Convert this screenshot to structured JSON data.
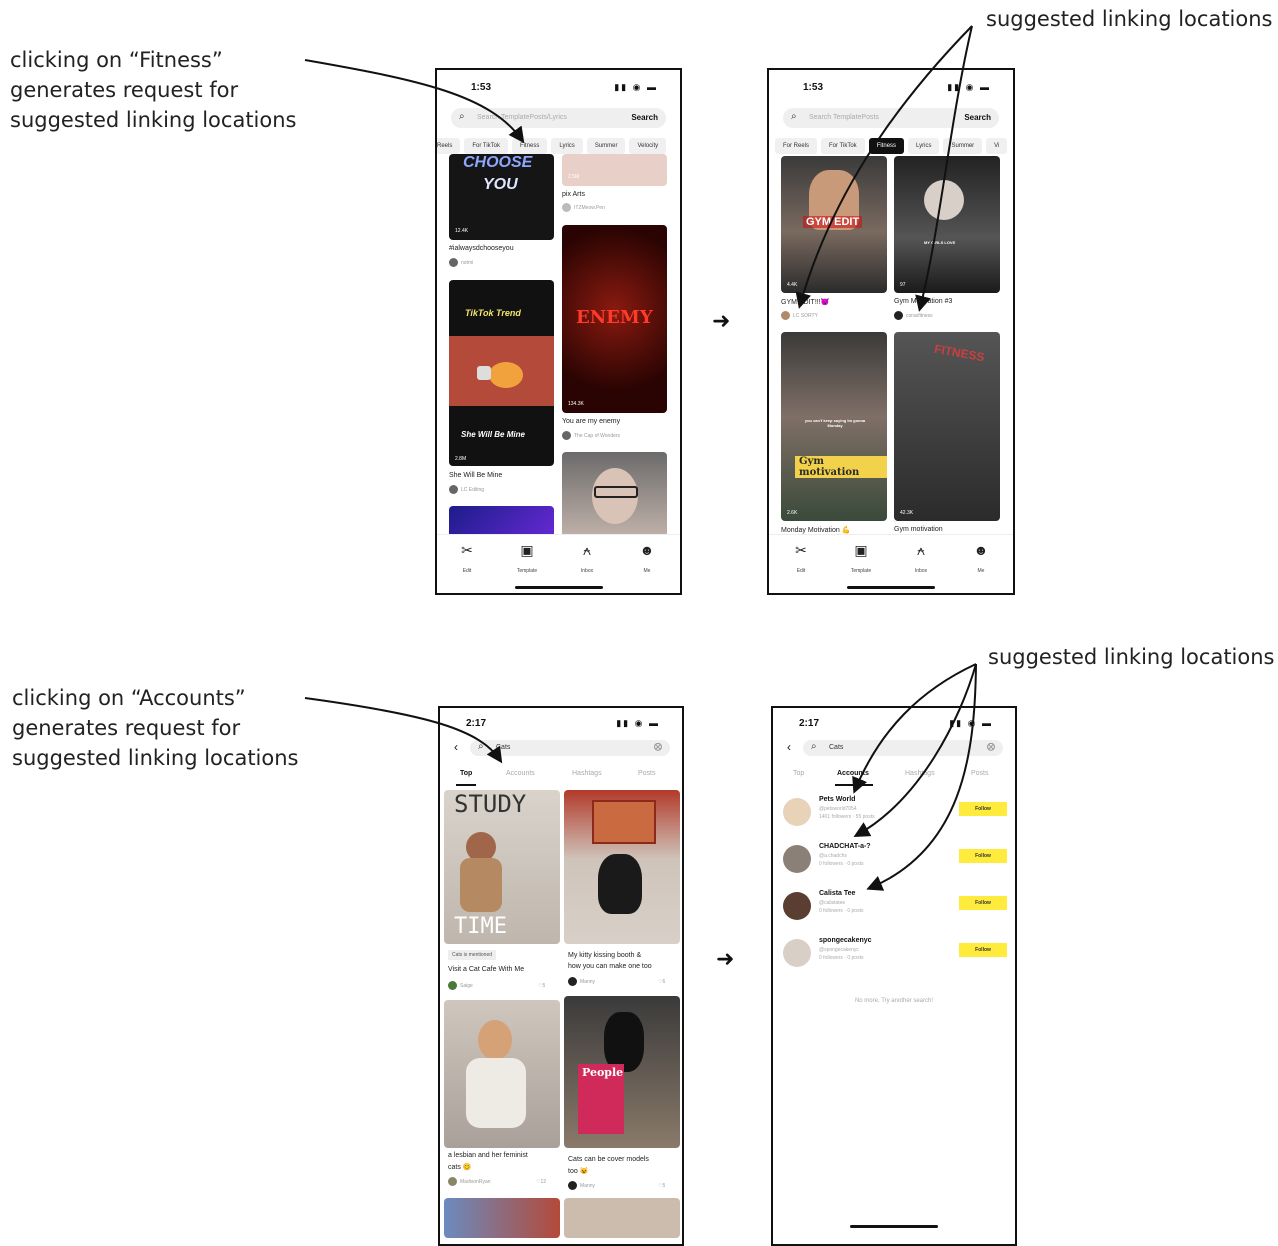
{
  "annotations": {
    "fitness_click_lines": [
      "clicking on “Fitness”",
      "generates request for",
      "suggested linking locations"
    ],
    "accounts_click_lines": [
      "clicking on “Accounts”",
      "generates request for",
      "suggested linking locations"
    ],
    "suggested_top": "suggested linking locations",
    "suggested_bottom": "suggested linking locations"
  },
  "fitness_before": {
    "time": "1:53",
    "search_placeholder": "Search TemplatePosts/Lyrics",
    "search_button": "Search",
    "chips": [
      "Reels",
      "For TikTok",
      "Fitness",
      "Lyrics",
      "Summer",
      "Velocity"
    ],
    "tiles": {
      "t1_text_a": "CHOOSE",
      "t1_text_b": "YOU",
      "t1_stat": "12.4K",
      "t1_caption": "#ialwaysdchooseyou",
      "t1_user": "notmi",
      "t2_stat": "2.5M",
      "t2_caption": "pix Arts",
      "t2_user": "ITZMeow.Pen",
      "t3_title_a": "TikTok Trend",
      "t3_title_b": "She Will Be Mine",
      "t3_stat": "2.8M",
      "t3_caption": "She Will Be Mine",
      "t3_user": "LC Editing",
      "t4_title": "ENEMY",
      "t4_stat": "134.3K",
      "t4_caption": "You are my enemy",
      "t4_user": "The Cap of Wonders"
    },
    "tabbar": [
      "Edit",
      "Template",
      "Inbox",
      "Me"
    ]
  },
  "fitness_after": {
    "time": "1:53",
    "search_placeholder": "Search TemplatePosts",
    "search_button": "Search",
    "chips": [
      "For Reels",
      "For TikTok",
      "Fitness",
      "Lyrics",
      "Summer",
      "Vi"
    ],
    "tiles": {
      "a1_overlay": "GYM EDIT",
      "a1_stat": "4.4K",
      "a1_caption": "GYM EDIT!!!😈",
      "a1_user": "LC SORTY",
      "a2_overlay": "MY GIRLS LOVE",
      "a2_stat": "97",
      "a2_caption": "Gym Motivation #3",
      "a2_user": "coraxfitness",
      "a3_overlay": "Gym motivation",
      "a3_small": "you can't keep saying Im gonna Monday",
      "a3_stat": "2.6K",
      "a3_caption": "Monday Motivation 💪",
      "a4_overlay": "FITNESS",
      "a4_stat": "42.3K",
      "a4_caption": "Gym motivation"
    },
    "tabbar": [
      "Edit",
      "Template",
      "Inbox",
      "Me"
    ]
  },
  "accounts_before": {
    "time": "2:17",
    "query": "Cats",
    "tabs": [
      "Top",
      "Accounts",
      "Hashtags",
      "Posts"
    ],
    "tiles": {
      "p1_overlay_a": "STUDY",
      "p1_overlay_b": "TIME",
      "p1_badge": "Cats is mentioned",
      "p1_caption": "Visit a Cat Cafe With Me",
      "p1_user": "Saige",
      "p1_likes": "5",
      "p2_caption_a": "My kitty kissing booth &",
      "p2_caption_b": "how you can make one too",
      "p2_user": "Manny",
      "p2_likes": "6",
      "p3_caption_a": "a lesbian and her feminist",
      "p3_caption_b": "cats 😊",
      "p3_user": "MadisonRyan",
      "p3_likes": "12",
      "p4_overlay": "People",
      "p4_caption_a": "Cats can be cover models",
      "p4_caption_b": "too 😺",
      "p4_user": "Manny",
      "p4_likes": "5"
    }
  },
  "accounts_after": {
    "time": "2:17",
    "query": "Cats",
    "tabs": [
      "Top",
      "Accounts",
      "Hashtags",
      "Posts"
    ],
    "accounts": [
      {
        "name": "Pets World",
        "handle": "@petsworld7054",
        "meta": "1401 followers · 55 posts",
        "follow": "Follow"
      },
      {
        "name": "CHADCHAT-a-?",
        "handle": "@a.chadchs",
        "meta": "0 followers · 0 posts",
        "follow": "Follow"
      },
      {
        "name": "Calista Tee",
        "handle": "@calistatee",
        "meta": "0 followers · 0 posts",
        "follow": "Follow"
      },
      {
        "name": "spongecakenyc",
        "handle": "@spongecakenyc",
        "meta": "0 followers · 0 posts",
        "follow": "Follow"
      }
    ],
    "no_more": "No more, Try another search!"
  }
}
